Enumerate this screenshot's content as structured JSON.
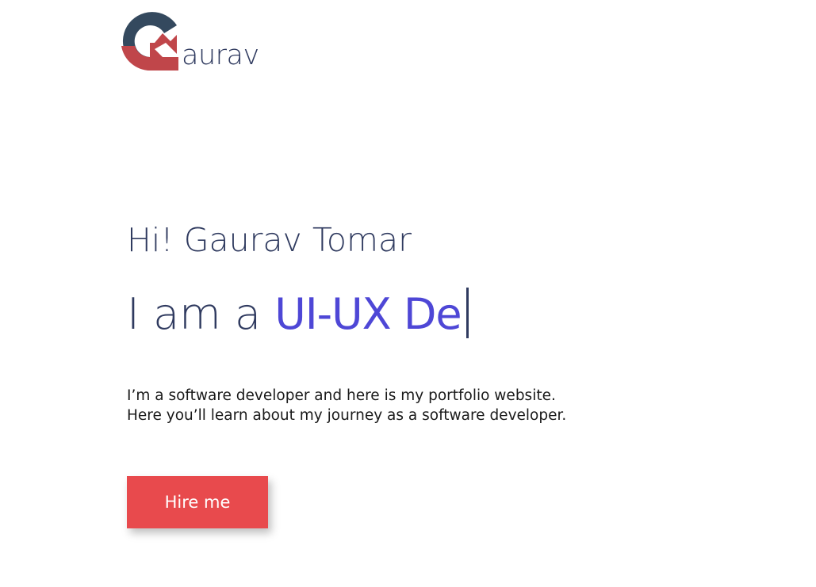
{
  "header": {
    "logo": {
      "initial": "G",
      "text": "aurav",
      "colors": {
        "primary": "#34495e",
        "accent": "#c0464a"
      }
    }
  },
  "hero": {
    "greeting": "Hi! Gaurav Tomar",
    "role_prefix": "I am a",
    "role_typed": "UI-UX De",
    "intro": "I’m a software developer and here is my portfolio website. Here you’ll learn about my journey as a software developer.",
    "cta_label": "Hire me"
  },
  "colors": {
    "text": "#2f3a5f",
    "highlight": "#4e47d6",
    "button": "#e84a4d"
  }
}
